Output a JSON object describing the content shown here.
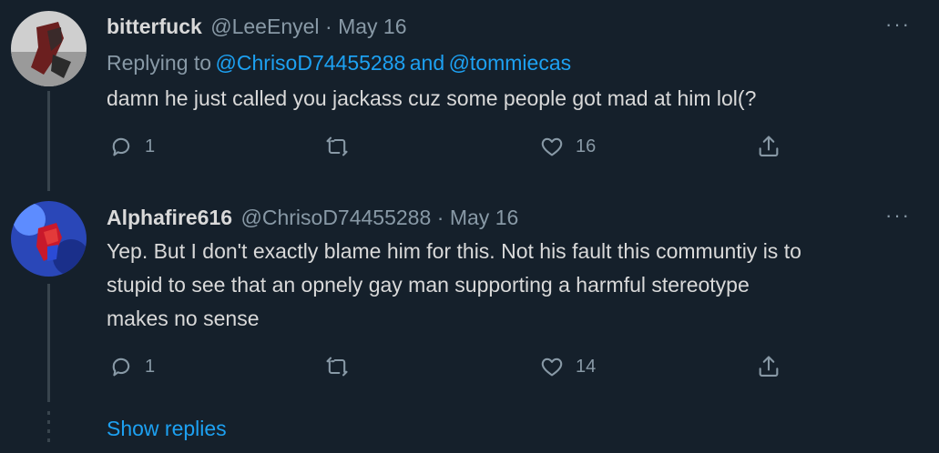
{
  "tweets": [
    {
      "display_name": "bitterfuck",
      "handle": "@LeeEnyel",
      "separator": "·",
      "date": "May 16",
      "replying_prefix": "Replying to",
      "replying_user1": "@ChrisoD74455288",
      "replying_and": "and",
      "replying_user2": "@tommiecas",
      "text_lines": [
        "damn he just called you jackass cuz some people got mad at him lol(?"
      ],
      "reply_count": "1",
      "like_count": "16"
    },
    {
      "display_name": "Alphafire616",
      "handle": "@ChrisoD74455288",
      "separator": "·",
      "date": "May 16",
      "text_lines": [
        "Yep. But I don't exactly blame him for this. Not his fault this communtiy is to",
        "stupid to see that an opnely gay man supporting a harmful stereotype",
        "makes no sense"
      ],
      "reply_count": "1",
      "like_count": "14"
    }
  ],
  "more_label": "···",
  "show_replies": "Show replies",
  "colors": {
    "background": "#15202b",
    "accent": "#1da1f2",
    "muted": "#8899a6",
    "text": "#d9d9d9",
    "thread": "#38444d"
  },
  "icons": [
    "reply-icon",
    "retweet-icon",
    "like-icon",
    "share-icon",
    "more-icon"
  ]
}
